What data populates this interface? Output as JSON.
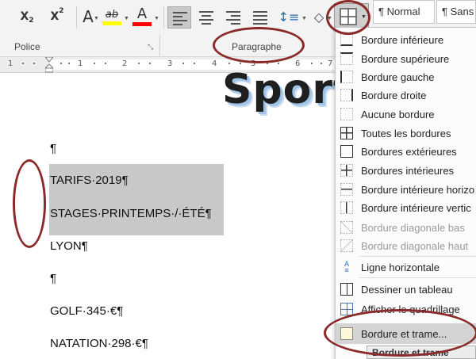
{
  "ribbon": {
    "subscript_label": "X",
    "subscript_mark": "2",
    "superscript_label": "X",
    "superscript_mark": "2",
    "highlight_label": "ab",
    "font_color_label": "A",
    "highlight_color": "#ffff00",
    "font_color": "#ff0000",
    "group_police": "Police",
    "group_paragraphe": "Paragraphe",
    "style_normal": "¶ Normal",
    "style_sans": "¶ Sans in"
  },
  "ruler": {
    "numbers": [
      "1",
      "1",
      "2",
      "3",
      "4",
      "5",
      "6",
      "7"
    ]
  },
  "document": {
    "title": "Sport",
    "lines": [
      "¶",
      "TARIFS·2019¶",
      "STAGES·PRINTEMPS·/·ÉTÉ¶",
      "LYON¶",
      "¶",
      "GOLF·345·€¶",
      "NATATION·298·€¶"
    ]
  },
  "border_menu": {
    "items": [
      {
        "label": "Bordure inférieure",
        "icon": "border-bottom-icon"
      },
      {
        "label": "Bordure supérieure",
        "icon": "border-top-icon"
      },
      {
        "label": "Bordure gauche",
        "icon": "border-left-icon"
      },
      {
        "label": "Bordure droite",
        "icon": "border-right-icon"
      },
      {
        "label": "Aucune bordure",
        "icon": "border-none-icon"
      },
      {
        "label": "Toutes les bordures",
        "icon": "border-all-icon"
      },
      {
        "label": "Bordures extérieures",
        "icon": "border-outside-icon"
      },
      {
        "label": "Bordures intérieures",
        "icon": "border-inside-icon"
      },
      {
        "label": "Bordure intérieure horizo",
        "icon": "border-inside-horizontal-icon"
      },
      {
        "label": "Bordure intérieure vertic",
        "icon": "border-inside-vertical-icon"
      },
      {
        "label": "Bordure diagonale bas",
        "icon": "border-diagonal-down-icon"
      },
      {
        "label": "Bordure diagonale haut",
        "icon": "border-diagonal-up-icon"
      },
      {
        "label": "Ligne horizontale",
        "icon": "horizontal-line-icon"
      },
      {
        "label": "Dessiner un tableau",
        "icon": "draw-table-icon"
      },
      {
        "label": "Afficher le quadrillage",
        "icon": "view-gridlines-icon"
      },
      {
        "label": "Bordure et trame...",
        "icon": "borders-shading-icon"
      }
    ],
    "tooltip": "Bordure et trame"
  },
  "annotation_color": "#8b2a2a"
}
